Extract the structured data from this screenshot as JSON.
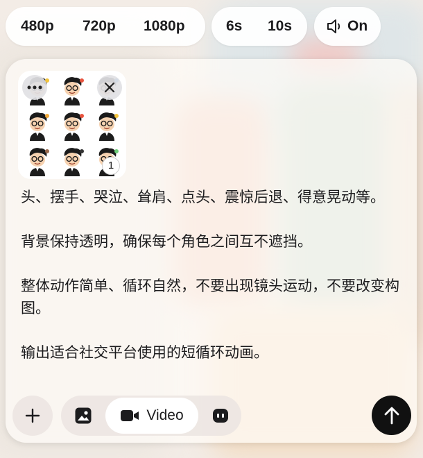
{
  "resolution_options": [
    "480p",
    "720p",
    "1080p"
  ],
  "duration_options": [
    "6s",
    "10s"
  ],
  "sound": {
    "label": "On",
    "icon": "speaker-icon"
  },
  "attachment": {
    "count_badge": "1",
    "more_icon": "ellipsis-icon",
    "remove_icon": "close-icon"
  },
  "prompt": {
    "paragraphs": [
      "头、摆手、哭泣、耸肩、点头、震惊后退、得意晃动等。",
      "背景保持透明，确保每个角色之间互不遮挡。",
      "整体动作简单、循环自然，不要出现镜头运动，不要改变构图。",
      "输出适合社交平台使用的短循环动画。"
    ]
  },
  "toolbar": {
    "add_icon": "plus-icon",
    "image_icon": "image-icon",
    "video_label": "Video",
    "video_icon": "video-camera-icon",
    "avatar_icon": "character-icon",
    "send_icon": "arrow-up-icon"
  },
  "colors": {
    "accent": "#111111",
    "card": "#fffcf8",
    "pill": "#ffffff"
  }
}
